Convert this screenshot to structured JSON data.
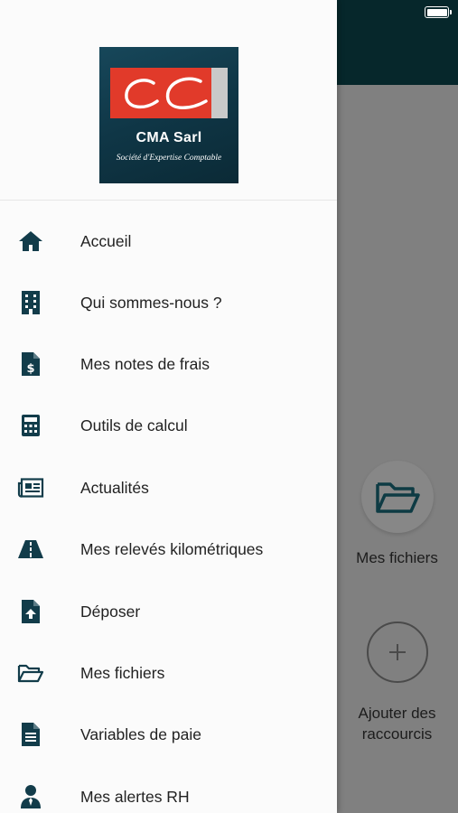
{
  "colors": {
    "header_dark": "#06272b",
    "icon_color": "#123c4a",
    "logo_red": "#e13a2a"
  },
  "logo": {
    "name": "CMA Sarl",
    "subtitle": "Société d'Expertise Comptable"
  },
  "menu": {
    "items": [
      {
        "label": "Accueil",
        "icon": "home-icon"
      },
      {
        "label": "Qui sommes-nous ?",
        "icon": "building-icon"
      },
      {
        "label": "Mes notes de frais",
        "icon": "invoice-dollar-icon"
      },
      {
        "label": "Outils de calcul",
        "icon": "calculator-icon"
      },
      {
        "label": "Actualités",
        "icon": "newspaper-icon"
      },
      {
        "label": "Mes relevés kilométriques",
        "icon": "road-icon"
      },
      {
        "label": "Déposer",
        "icon": "file-upload-icon"
      },
      {
        "label": "Mes fichiers",
        "icon": "folder-open-icon"
      },
      {
        "label": "Variables de paie",
        "icon": "file-text-icon"
      },
      {
        "label": "Mes alertes RH",
        "icon": "user-tie-icon"
      }
    ]
  },
  "background": {
    "tiles": [
      {
        "label": "Mes fichiers",
        "icon": "folder-open-icon"
      },
      {
        "label": "Ajouter des raccourcis",
        "icon": "plus-icon"
      }
    ]
  }
}
